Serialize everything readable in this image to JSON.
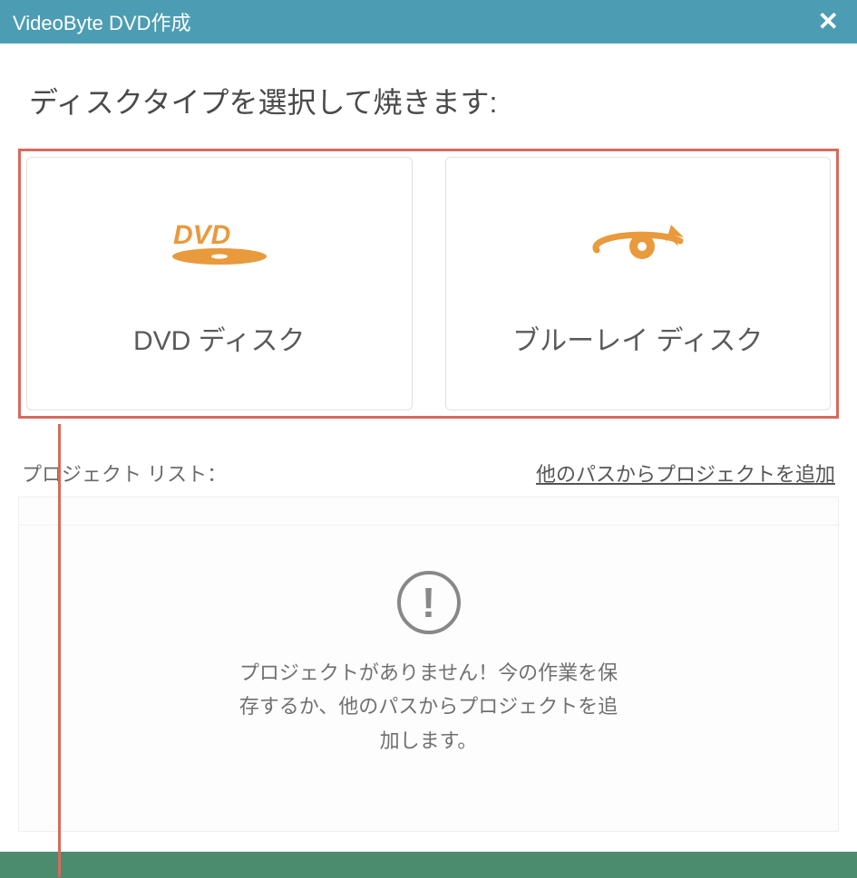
{
  "window": {
    "title": "VideoByte DVD作成"
  },
  "heading": "ディスクタイプを選択して焼きます:",
  "disc_options": {
    "dvd": {
      "label": "DVD ディスク"
    },
    "bluray": {
      "label": "ブルーレイ ディスク"
    }
  },
  "project": {
    "list_label": "プロジェクト リスト：",
    "add_label": "他のパスからプロジェクトを追加",
    "empty_message": "プロジェクトがありません！今の作業を保存するか、他のパスからプロジェクトを追加します。"
  },
  "colors": {
    "accent": "#e89a3c",
    "titlebar": "#4c9db3",
    "highlight_border": "#d66a5e"
  }
}
